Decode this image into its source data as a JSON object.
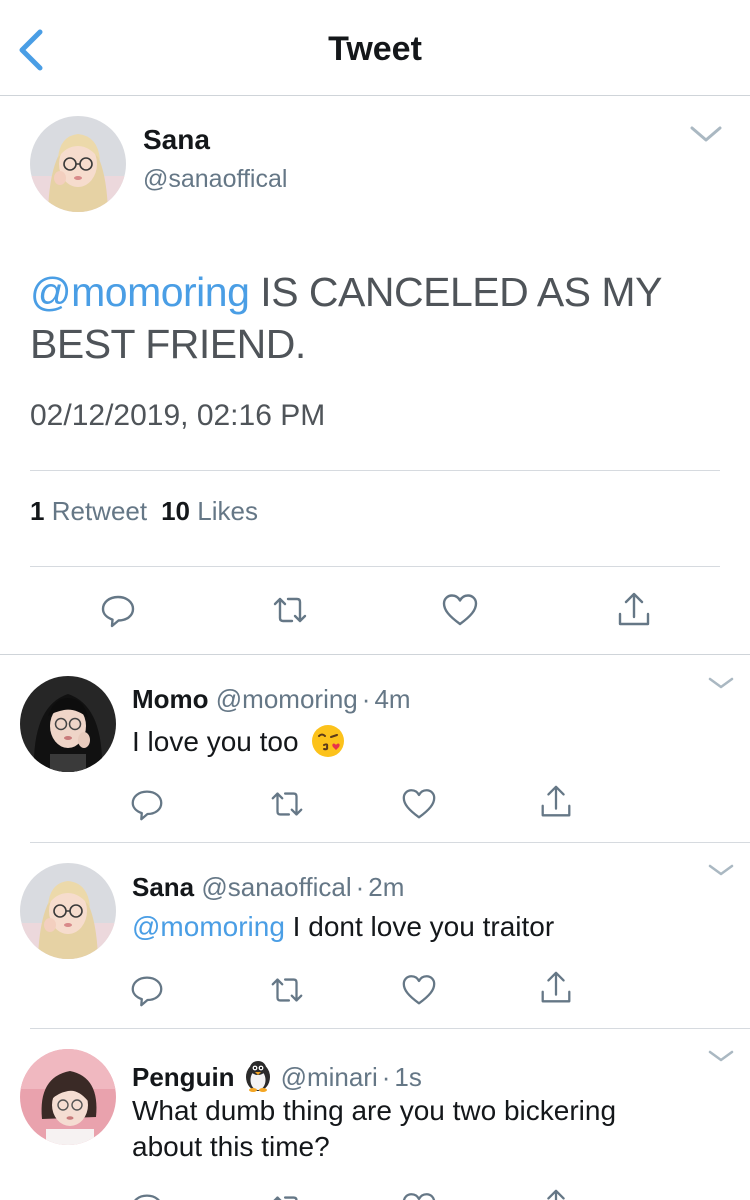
{
  "header": {
    "title": "Tweet",
    "back_icon": "chevron-left-icon"
  },
  "colors": {
    "link": "#4a9ee5",
    "muted": "#657786",
    "text": "#14171a"
  },
  "main_tweet": {
    "name": "Sana",
    "handle": "@sanaoffical",
    "mention": "@momoring",
    "text": " IS CANCELED AS MY BEST FRIEND.",
    "timestamp": "02/12/2019, 02:16 PM",
    "retweets_count": "1",
    "retweets_label": "Retweet",
    "likes_count": "10",
    "likes_label": "Likes",
    "actions": [
      "reply-icon",
      "retweet-icon",
      "like-icon",
      "share-icon"
    ]
  },
  "replies": [
    {
      "name": "Momo",
      "handle": "@momoring",
      "time": "4m",
      "text": "I love you too",
      "emoji": "kissing-face-with-heart-emoji"
    },
    {
      "name": "Sana",
      "handle": "@sanaoffical",
      "time": "2m",
      "mention": "@momoring",
      "text": " I dont love you traitor"
    },
    {
      "name": "Penguin",
      "name_emoji": "penguin-emoji",
      "handle": "@minari",
      "time": "1s",
      "text": "What dumb thing are you two bickering about this time?"
    }
  ]
}
